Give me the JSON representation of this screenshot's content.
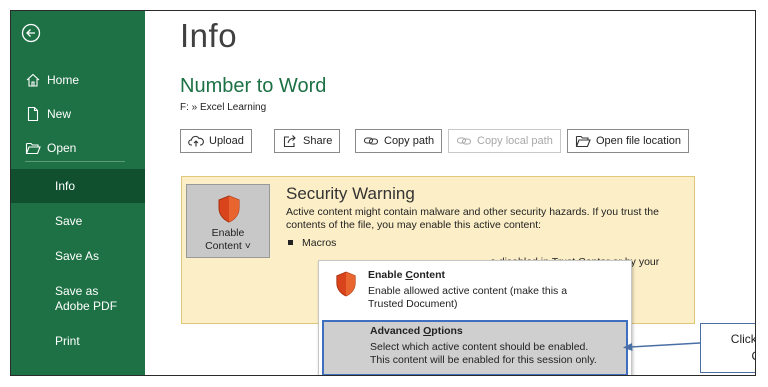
{
  "sidebar": {
    "items": [
      {
        "label": "Home",
        "icon": "home-icon"
      },
      {
        "label": "New",
        "icon": "new-document-icon"
      },
      {
        "label": "Open",
        "icon": "open-folder-icon"
      },
      {
        "label": "Info"
      },
      {
        "label": "Save"
      },
      {
        "label": "Save As"
      },
      {
        "label": "Save as Adobe PDF"
      },
      {
        "label": "Print"
      }
    ],
    "active": "Info",
    "bg_color": "#1e7145",
    "active_color": "#10502f"
  },
  "main": {
    "title": "Info",
    "doc_title": "Number to Word",
    "path": "F: » Excel Learning",
    "buttons": [
      {
        "label": "Upload",
        "icon": "upload-icon",
        "enabled": true
      },
      {
        "label": "Share",
        "icon": "share-icon",
        "enabled": true
      },
      {
        "label": "Copy path",
        "icon": "link-icon",
        "enabled": true
      },
      {
        "label": "Copy local path",
        "icon": "link-icon",
        "enabled": false
      },
      {
        "label": "Open file location",
        "icon": "folder-icon",
        "enabled": true
      }
    ]
  },
  "security": {
    "enable_button_line1": "Enable",
    "enable_button_line2": "Content",
    "title": "Security Warning",
    "text": "Active content might contain malware and other security hazards. If you trust the contents of the file, you may enable this active content:",
    "bullet": "Macros",
    "partial_text": "e disabled in Trust Center or by your",
    "box_color": "#fcefc7"
  },
  "dropdown": {
    "enable_title_pre": "Enable ",
    "enable_title_u": "C",
    "enable_title_post": "ontent",
    "enable_desc_1": "Enable allowed active content (make this a",
    "enable_desc_2": "Trusted Document)",
    "advanced_title_pre": "Advanced ",
    "advanced_title_u": "O",
    "advanced_title_post": "ptions",
    "advanced_desc_1": "Select which active content should be enabled.",
    "advanced_desc_2": "This content will be enabled for this session only."
  },
  "callout": {
    "line1": "Click on the “Advanced",
    "line2": "Options” button"
  }
}
